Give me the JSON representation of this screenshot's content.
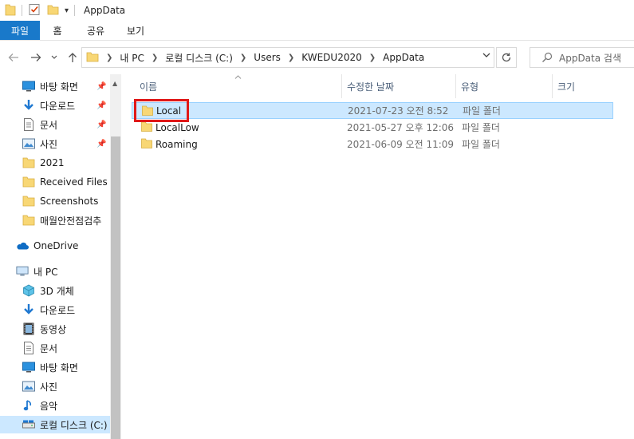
{
  "window": {
    "title": "AppData",
    "quick_access_dropdown_glyph": "▾"
  },
  "ribbon": {
    "tabs": [
      {
        "label": "파일"
      },
      {
        "label": "홈"
      },
      {
        "label": "공유"
      },
      {
        "label": "보기"
      }
    ]
  },
  "addressbar": {
    "breadcrumbs": [
      {
        "label": "내 PC"
      },
      {
        "label": "로컬 디스크 (C:)"
      },
      {
        "label": "Users"
      },
      {
        "label": "KWEDU2020"
      },
      {
        "label": "AppData"
      }
    ]
  },
  "search": {
    "placeholder": "AppData 검색"
  },
  "navigation": {
    "quick_access": [
      {
        "label": "바탕 화면",
        "icon": "desktop-icon",
        "pinned": true
      },
      {
        "label": "다운로드",
        "icon": "download-icon",
        "pinned": true
      },
      {
        "label": "문서",
        "icon": "document-icon",
        "pinned": true
      },
      {
        "label": "사진",
        "icon": "pictures-icon",
        "pinned": true
      },
      {
        "label": "2021",
        "icon": "folder-icon",
        "pinned": false
      },
      {
        "label": "Received Files",
        "icon": "folder-icon",
        "pinned": false
      },
      {
        "label": "Screenshots",
        "icon": "folder-icon",
        "pinned": false
      },
      {
        "label": "매월안전점검추",
        "icon": "folder-icon",
        "pinned": false
      }
    ],
    "onedrive": {
      "label": "OneDrive",
      "icon": "onedrive-icon"
    },
    "this_pc": {
      "label": "내 PC",
      "icon": "pc-icon"
    },
    "this_pc_items": [
      {
        "label": "3D 개체",
        "icon": "3d-objects-icon"
      },
      {
        "label": "다운로드",
        "icon": "download-icon"
      },
      {
        "label": "동영상",
        "icon": "video-icon"
      },
      {
        "label": "문서",
        "icon": "document-icon"
      },
      {
        "label": "바탕 화면",
        "icon": "desktop-icon"
      },
      {
        "label": "사진",
        "icon": "pictures-icon"
      },
      {
        "label": "음악",
        "icon": "music-icon"
      },
      {
        "label": "로컬 디스크 (C:)",
        "icon": "drive-icon",
        "selected": true
      }
    ]
  },
  "file_list": {
    "columns": [
      {
        "label": "이름"
      },
      {
        "label": "수정한 날짜"
      },
      {
        "label": "유형"
      },
      {
        "label": "크기"
      }
    ],
    "rows": [
      {
        "name": "Local",
        "modified": "2021-07-23 오전 8:52",
        "type": "파일 폴더",
        "size": "",
        "selected": true
      },
      {
        "name": "LocalLow",
        "modified": "2021-05-27 오후 12:06",
        "type": "파일 폴더",
        "size": "",
        "selected": false
      },
      {
        "name": "Roaming",
        "modified": "2021-06-09 오전 11:09",
        "type": "파일 폴더",
        "size": "",
        "selected": false
      }
    ]
  },
  "colors": {
    "accent": "#1979ca",
    "selection": "#cce8ff",
    "highlight_box": "#e01818",
    "folder": "#f8d775"
  }
}
